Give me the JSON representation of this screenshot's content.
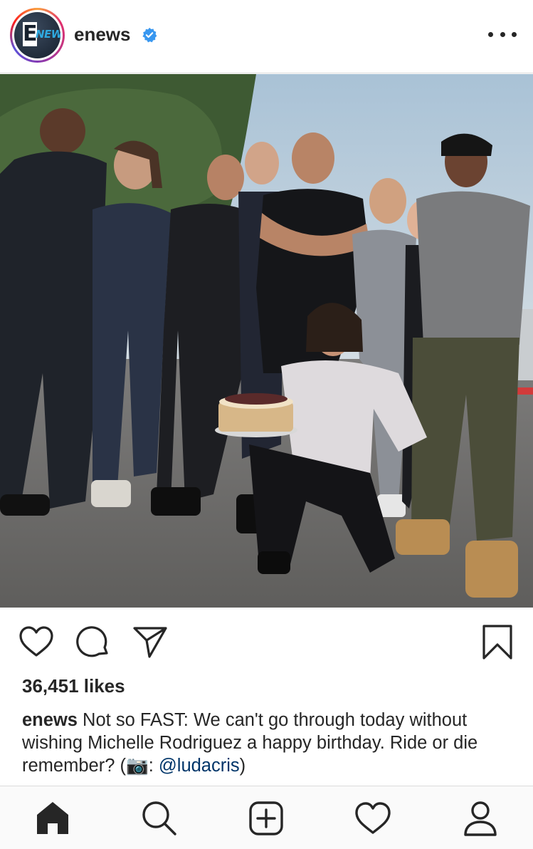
{
  "post": {
    "username": "enews",
    "verified_icon": "verified-badge-icon",
    "avatar_logo": {
      "letter": "E",
      "word": "NEWS"
    },
    "photo_description_icon": "group-photo",
    "likes_text": "36,451 likes",
    "caption": {
      "username": "enews",
      "text_1": " Not so FAST: We can't go through today without wishing Michelle Rodriguez a happy birthday. Ride or die remember? (",
      "emoji": "📷",
      "text_2": ": ",
      "mention": "@ludacris",
      "text_3": ")"
    }
  },
  "actions": {
    "like_icon": "heart-icon",
    "comment_icon": "comment-icon",
    "share_icon": "paper-plane-icon",
    "save_icon": "bookmark-icon"
  },
  "bottom_nav": [
    "home-icon",
    "search-icon",
    "new-post-icon",
    "activity-icon",
    "profile-icon"
  ],
  "colors": {
    "verified": "#3897f0",
    "mention": "#003569",
    "text": "#262626"
  }
}
